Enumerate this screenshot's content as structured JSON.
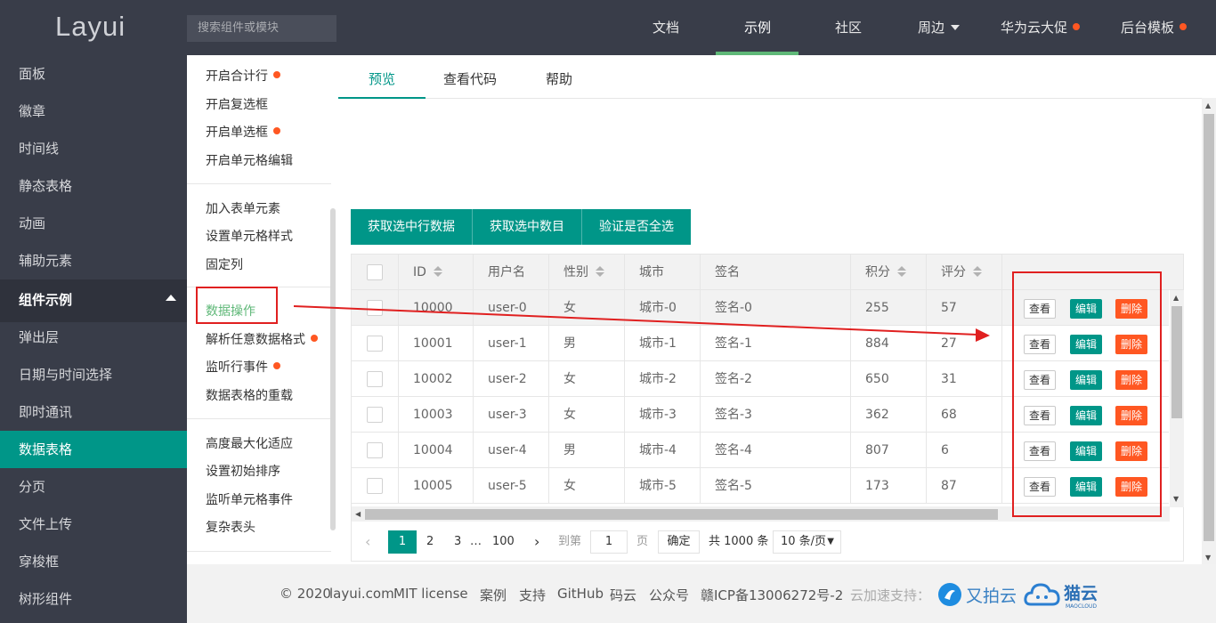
{
  "header": {
    "logo": "Layui",
    "search_placeholder": "搜索组件或模块",
    "nav": [
      {
        "label": "文档"
      },
      {
        "label": "示例"
      },
      {
        "label": "社区"
      },
      {
        "label": "周边"
      },
      {
        "label": "华为云大促"
      },
      {
        "label": "后台模板"
      }
    ]
  },
  "sidebar": {
    "items": [
      {
        "label": "面板"
      },
      {
        "label": "徽章"
      },
      {
        "label": "时间线"
      },
      {
        "label": "静态表格"
      },
      {
        "label": "动画"
      },
      {
        "label": "辅助元素"
      },
      {
        "label": "组件示例"
      },
      {
        "label": "弹出层"
      },
      {
        "label": "日期与时间选择"
      },
      {
        "label": "即时通讯"
      },
      {
        "label": "数据表格"
      },
      {
        "label": "分页"
      },
      {
        "label": "文件上传"
      },
      {
        "label": "穿梭框"
      },
      {
        "label": "树形组件"
      }
    ]
  },
  "submenu": {
    "items": [
      {
        "label": "开启合计行"
      },
      {
        "label": "开启复选框"
      },
      {
        "label": "开启单选框"
      },
      {
        "label": "开启单元格编辑"
      },
      {
        "label": "加入表单元素"
      },
      {
        "label": "设置单元格样式"
      },
      {
        "label": "固定列"
      },
      {
        "label": "数据操作"
      },
      {
        "label": "解析任意数据格式"
      },
      {
        "label": "监听行事件"
      },
      {
        "label": "数据表格的重载"
      },
      {
        "label": "高度最大化适应"
      },
      {
        "label": "设置初始排序"
      },
      {
        "label": "监听单元格事件"
      },
      {
        "label": "复杂表头"
      }
    ]
  },
  "tabs": [
    "预览",
    "查看代码",
    "帮助"
  ],
  "toolbar": {
    "btn_get_rows": "获取选中行数据",
    "btn_get_count": "获取选中数目",
    "btn_check_all": "验证是否全选"
  },
  "table": {
    "headers": {
      "id": "ID",
      "username": "用户名",
      "sex": "性别",
      "city": "城市",
      "sign": "签名",
      "score": "积分",
      "rating": "评分"
    },
    "rows": [
      {
        "id": "10000",
        "username": "user-0",
        "sex": "女",
        "city": "城市-0",
        "sign": "签名-0",
        "score": "255",
        "rating": "57"
      },
      {
        "id": "10001",
        "username": "user-1",
        "sex": "男",
        "city": "城市-1",
        "sign": "签名-1",
        "score": "884",
        "rating": "27"
      },
      {
        "id": "10002",
        "username": "user-2",
        "sex": "女",
        "city": "城市-2",
        "sign": "签名-2",
        "score": "650",
        "rating": "31"
      },
      {
        "id": "10003",
        "username": "user-3",
        "sex": "女",
        "city": "城市-3",
        "sign": "签名-3",
        "score": "362",
        "rating": "68"
      },
      {
        "id": "10004",
        "username": "user-4",
        "sex": "男",
        "city": "城市-4",
        "sign": "签名-4",
        "score": "807",
        "rating": "6"
      },
      {
        "id": "10005",
        "username": "user-5",
        "sex": "女",
        "city": "城市-5",
        "sign": "签名-5",
        "score": "173",
        "rating": "87"
      }
    ],
    "actions": {
      "view": "查看",
      "edit": "编辑",
      "delete": "删除"
    }
  },
  "pager": {
    "current": "1",
    "page2": "2",
    "page3": "3",
    "ellipsis": "…",
    "last": "100",
    "goto_label": "到第",
    "goto_value": "1",
    "page_unit": "页",
    "confirm": "确定",
    "total": "共 1000 条",
    "page_size": "10 条/页"
  },
  "footer": {
    "copyright": "© 2020",
    "site": "layui.com",
    "license": "MIT license",
    "links": [
      "案例",
      "支持",
      "GitHub",
      "码云",
      "公众号"
    ],
    "icp": "赣ICP备13006272号-2",
    "cdn_label": "云加速支持：",
    "sponsor1": "又拍云",
    "sponsor2": "猫云",
    "sponsor2_sub": "MAOCLOUD"
  },
  "colors": {
    "primary": "#009688",
    "danger": "#ff5722",
    "header_bg": "#393d49",
    "annotation": "#e02020"
  }
}
